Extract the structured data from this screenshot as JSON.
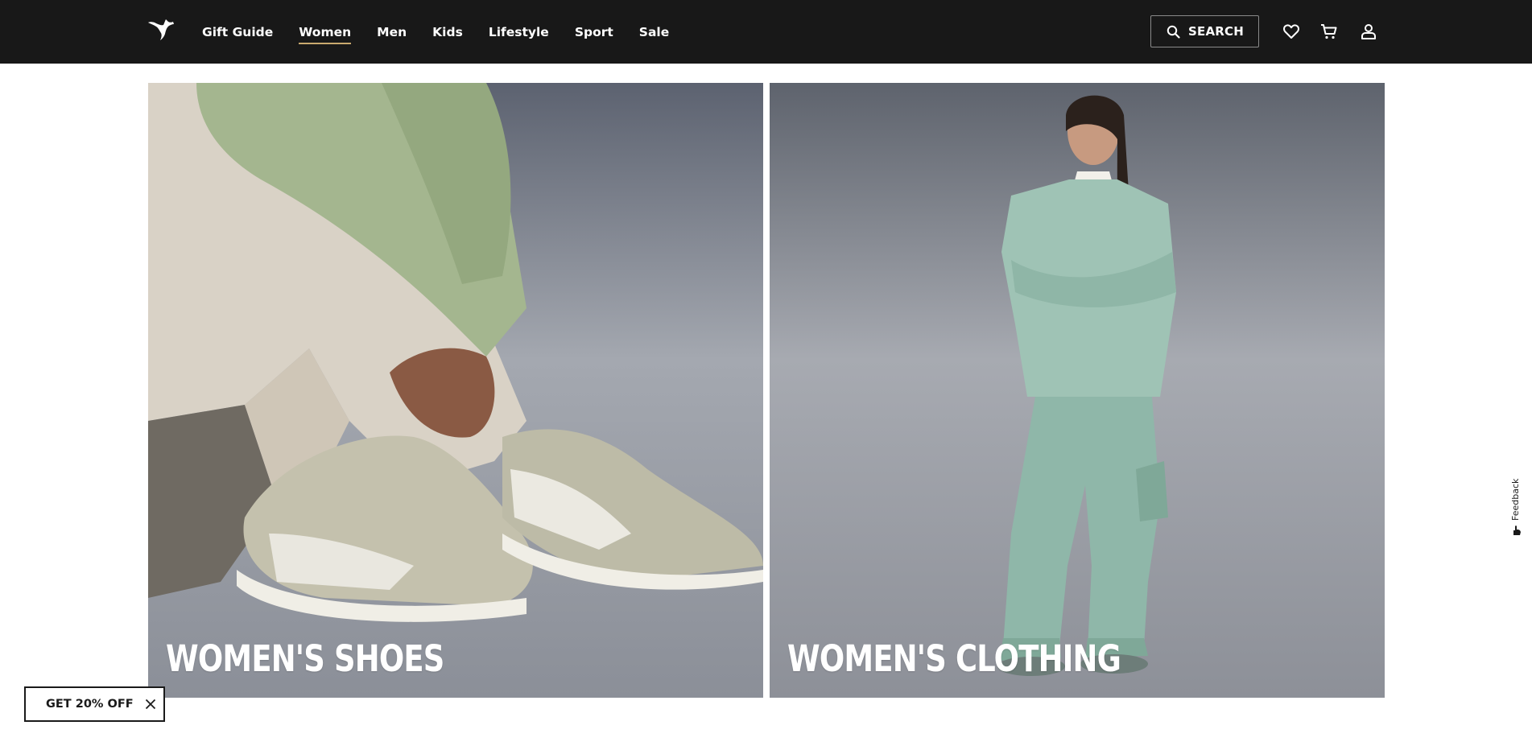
{
  "header": {
    "nav": [
      "Gift Guide",
      "Women",
      "Men",
      "Kids",
      "Lifestyle",
      "Sport",
      "Sale"
    ],
    "active_nav": "Women",
    "search_label": "SEARCH",
    "icons": [
      "puma-logo-icon",
      "search-icon",
      "heart-icon",
      "cart-icon",
      "user-icon"
    ],
    "colors": {
      "bar": "#181818",
      "active_underline": "#c9a96e"
    }
  },
  "tiles": [
    {
      "title": "WOMEN'S SHOES"
    },
    {
      "title": "WOMEN'S CLOTHING"
    }
  ],
  "promo": {
    "label": "GET 20% OFF",
    "close_icon": "close-icon"
  },
  "feedback": {
    "label": "Feedback"
  }
}
